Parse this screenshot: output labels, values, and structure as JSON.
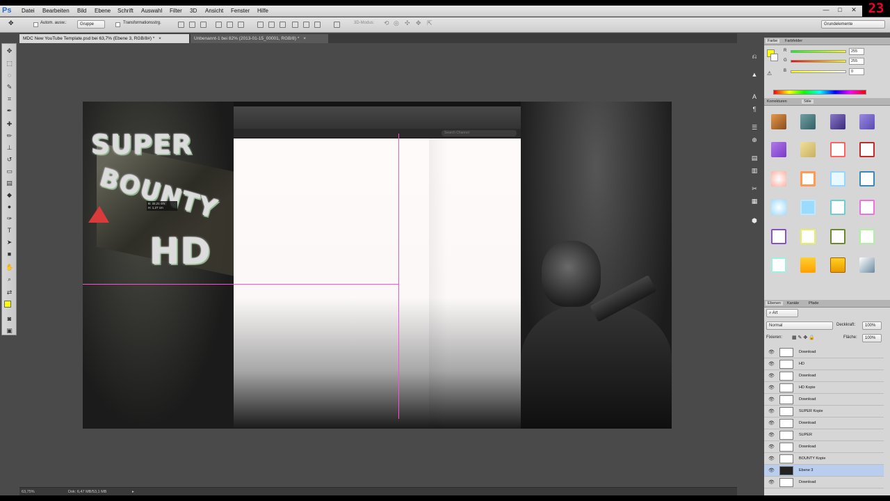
{
  "app": {
    "logo": "Ps",
    "menu": [
      "Datei",
      "Bearbeiten",
      "Bild",
      "Ebene",
      "Schrift",
      "Auswahl",
      "Filter",
      "3D",
      "Ansicht",
      "Fenster",
      "Hilfe"
    ],
    "window_controls": {
      "minimize": "—",
      "maximize": "□",
      "close": "✕"
    },
    "recording_badge": "23"
  },
  "options": {
    "auto_select_label": "Autom. ausw.:",
    "auto_select_value": "Gruppe",
    "transform_label": "Transformationsstrg.",
    "mode_3d_label": "3D-Modus:",
    "workspace": "Grundelemente"
  },
  "tabs": [
    {
      "label": "MDC New YouTube Template.psd bei 63,7% (Ebene 3, RGB/8#) *",
      "close": "×"
    },
    {
      "label": "Unbenannt-1 bei 82% (2013-01-15_00001, RGB/8) *",
      "close": "×"
    }
  ],
  "canvas": {
    "logo_words": [
      "SUPER",
      "BOUNTY",
      "HD"
    ],
    "search_placeholder": "Search Channel",
    "measure_tooltip": [
      "B: 32,21 cm",
      "H: 1,27 cm"
    ]
  },
  "status": {
    "zoom": "63,75%",
    "doc_info": "Dok: 6,47 MB/53,1 MB"
  },
  "colors_panel": {
    "tabs": [
      "Farbe",
      "Farbfelder"
    ],
    "channels": [
      {
        "label": "R",
        "value": "255"
      },
      {
        "label": "G",
        "value": "255"
      },
      {
        "label": "B",
        "value": "0"
      }
    ],
    "foreground": "#ffff00"
  },
  "styles_panel": {
    "tabs": [
      "Korrekturen",
      "Stile"
    ]
  },
  "layers_panel": {
    "tabs": [
      "Ebenen",
      "Kanäle",
      "Pfade"
    ],
    "filter": "Art",
    "blend_mode": "Normal",
    "opacity_label": "Deckkraft:",
    "opacity": "100%",
    "lock_label": "Fixieren:",
    "fill_label": "Fläche:",
    "fill": "100%",
    "layers": [
      {
        "name": "Download",
        "selected": false
      },
      {
        "name": "HD",
        "selected": false
      },
      {
        "name": "Download",
        "selected": false
      },
      {
        "name": "HD Kopie",
        "selected": false
      },
      {
        "name": "Download",
        "selected": false
      },
      {
        "name": "SUPER Kopie",
        "selected": false
      },
      {
        "name": "Download",
        "selected": false
      },
      {
        "name": "SUPER",
        "selected": false
      },
      {
        "name": "Download",
        "selected": false
      },
      {
        "name": "BOUNTY Kopie",
        "selected": false
      },
      {
        "name": "Ebene 3",
        "selected": true
      },
      {
        "name": "Download",
        "selected": false
      }
    ]
  }
}
